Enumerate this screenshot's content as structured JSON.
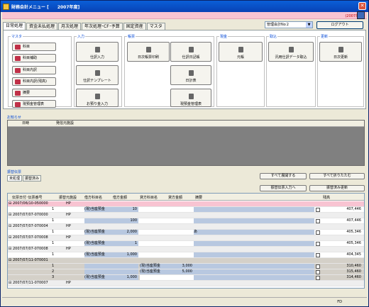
{
  "window": {
    "title": "財務会計メニュー [　　2007年度]"
  },
  "header": {
    "fiscal_year": "(2007年度)"
  },
  "tabs": [
    "日常処理",
    "資金未払処理",
    "月次処理",
    "年次処理･CF･予算",
    "固定資産",
    "マスタ"
  ],
  "company_select": {
    "value": "管理会計No２"
  },
  "logout_label": "ログアウト",
  "groups": {
    "master": {
      "label": "マスタ",
      "items": [
        "科目",
        "科目補助",
        "科目内訳",
        "科目内訳(残高)",
        "摘要",
        "現預金管理表"
      ]
    },
    "input": {
      "label": "入力",
      "items": [
        "仕訳入力",
        "仕訳テンプレート",
        "お預り金入力"
      ]
    },
    "ledger": {
      "label": "帳票",
      "items": [
        "日次帳票印刷",
        "仕訳日記帳",
        "日計表",
        "現預金管理表"
      ]
    },
    "cash": {
      "label": "現金",
      "items": [
        "元帳"
      ]
    },
    "link": {
      "label": "取込",
      "items": [
        "汎用仕訳データ取込"
      ]
    },
    "update": {
      "label": "更新",
      "items": [
        "日次更新"
      ]
    }
  },
  "notice": {
    "label": "お知らせ",
    "columns": [
      "日時",
      "発信元施設"
    ]
  },
  "entries": {
    "label": "振替伝票",
    "tabs": [
      "未処理",
      "振替済み"
    ],
    "collapse_all": "すべて展開する",
    "expand_all": "すべて折りたたむ",
    "print_button": "振替伝票入力へ",
    "update_button": "振替済み更新",
    "columns": [
      "伝票日付･伝票番号",
      "振替元施設",
      "借方科目名",
      "借方金額",
      "貸方科目名",
      "貸方金額",
      "摘要",
      "残高"
    ],
    "rows": [
      {
        "type": "head",
        "no": "2007/06/10-050000",
        "facility": "HP",
        "highlight": true
      },
      {
        "type": "line",
        "line": "1",
        "dr_name": "(現)当座預金",
        "dr_amt": "10",
        "balance": "407,446"
      },
      {
        "type": "head",
        "no": "2007/07/07-070000",
        "facility": "HP"
      },
      {
        "type": "line",
        "line": "1",
        "dr_name": "",
        "dr_amt": "100",
        "balance": "407,446"
      },
      {
        "type": "head",
        "no": "2007/07/07-070004",
        "facility": "HP"
      },
      {
        "type": "line",
        "line": "1",
        "dr_name": "(現)当座預金",
        "dr_amt": "2,000",
        "memo": "あ",
        "balance": "405,346"
      },
      {
        "type": "head",
        "no": "2007/07/07-070008",
        "facility": "HP"
      },
      {
        "type": "line",
        "line": "1",
        "dr_name": "(現)当座預金",
        "dr_amt": "1",
        "balance": "405,346"
      },
      {
        "type": "head",
        "no": "2007/07/07-070008",
        "facility": "HP"
      },
      {
        "type": "line",
        "line": "1",
        "dr_name": "(現)当座預金",
        "dr_amt": "1,000",
        "balance": "404,345"
      },
      {
        "type": "head",
        "no": "2007/07/11-070001",
        "facility": "",
        "grey": true
      },
      {
        "type": "line",
        "line": "1",
        "cr_name": "(現)当座預金",
        "cr_amt": "3,000",
        "balance": "310,460",
        "grey": true
      },
      {
        "type": "line",
        "line": "2",
        "cr_name": "(現)当座預金",
        "cr_amt": "5,000",
        "balance": "315,460",
        "grey": true
      },
      {
        "type": "line",
        "line": "3",
        "dr_name": "(現)当座預金",
        "dr_amt": "1,000",
        "balance": "314,460",
        "grey": true
      },
      {
        "type": "head",
        "no": "2007/07/11-070007",
        "facility": "HP"
      }
    ]
  },
  "status": {
    "right": "FD"
  }
}
